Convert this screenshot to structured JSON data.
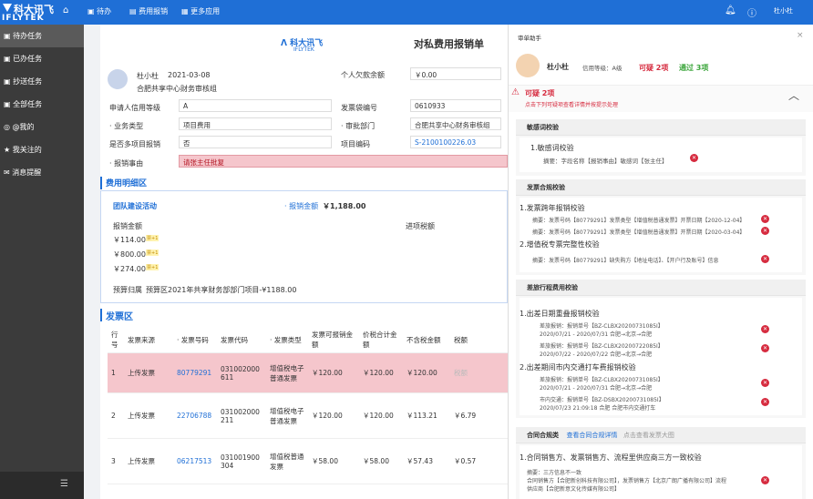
{
  "topbar": {
    "logo_cn": "科大讯飞",
    "logo_en": "IFLYTEK",
    "home_icon": "home-icon",
    "nav": [
      {
        "icon": "list-icon",
        "label": "待办"
      },
      {
        "icon": "money-icon",
        "label": "费用报销"
      },
      {
        "icon": "grid-icon",
        "label": "更多应用"
      }
    ],
    "user": "杜小杜"
  },
  "sidebar": {
    "items": [
      "待办任务",
      "已办任务",
      "抄送任务",
      "全部任务",
      "@我的",
      "我关注的",
      "消息提醒"
    ]
  },
  "form": {
    "brand_cn": "科大讯飞",
    "brand_en": "IFLYTEK",
    "title": "对私费用报销单",
    "applicant": "杜小杜",
    "date": "2021-03-08",
    "dept": "合肥共享中心财务审核组",
    "fields": [
      {
        "label": "个人欠款余额",
        "value": "￥0.00"
      },
      {
        "label": "申请人信用等级",
        "value": "A"
      },
      {
        "label": "发票袋编号",
        "value": "0610933"
      },
      {
        "label": "· 业务类型",
        "value": "项目费用"
      },
      {
        "label": "· 审批部门",
        "value": "合肥共享中心财务审核组"
      },
      {
        "label": "是否多项目报销",
        "value": "否"
      },
      {
        "label": "项目编码",
        "value": "S-2100100226.03"
      },
      {
        "label": "· 报销事由",
        "value": "请张主任批复"
      }
    ],
    "detail": {
      "title": "费用明细区",
      "activity": "团队建设活动",
      "amount_label": "· 报销金额",
      "amount": "￥1,188.00",
      "col1": "报销金额",
      "col2": "进项税额",
      "rows": [
        "￥114.00",
        "￥800.00",
        "￥274.00"
      ],
      "badge": "票+1",
      "budget_label": "预算归属",
      "budget": "预算区2021年共享财务部部门项目-¥1188.00"
    },
    "invoice": {
      "title": "发票区",
      "headers": [
        "行号",
        "发票来源",
        "· 发票号码",
        "发票代码",
        "· 发票类型",
        "发票可报销金额",
        "价税合计金额",
        "不含税金额",
        "税额"
      ],
      "rows": [
        {
          "no": "1",
          "source": "上传发票",
          "number": "80779291",
          "code": "031002000611",
          "type": "增值税电子普通发票",
          "avail": "￥120.00",
          "total": "￥120.00",
          "net": "￥120.00",
          "tax": "税额"
        },
        {
          "no": "2",
          "source": "上传发票",
          "number": "22706788",
          "code": "031002000211",
          "type": "增值税电子普通发票",
          "avail": "￥120.00",
          "total": "￥120.00",
          "net": "￥113.21",
          "tax": "￥6.79"
        },
        {
          "no": "3",
          "source": "上传发票",
          "number": "06217513",
          "code": "031001900304",
          "type": "增值税普通发票",
          "avail": "￥58.00",
          "total": "￥58.00",
          "net": "￥57.43",
          "tax": "￥0.57"
        }
      ]
    }
  },
  "assistant": {
    "title": "审单助手",
    "user": "杜小杜",
    "credit": "信用等级：A级",
    "doubt": "可疑 2项",
    "pass": "通过 3项",
    "alert_title": "可疑 2项",
    "alert_sub": "点击下列可疑项查看详情并按提示处理",
    "groups": [
      {
        "title": "敏感词校验",
        "items": [
          {
            "name": "1.敏感词校验",
            "lines": [
              "摘要：字段名称【报销事由】敏感词【张主任】"
            ]
          }
        ]
      },
      {
        "title": "发票合规校验",
        "items": [
          {
            "name": "1.发票跨年报销校验",
            "lines": [
              "摘要：发票号码【80779291】发票类型【增值税普通发票】开票日期【2020-12-04】",
              "摘要：发票号码【80779291】发票类型【增值税普通发票】开票日期【2020-03-04】"
            ]
          },
          {
            "name": "2.增值税专票完整性校验",
            "lines": [
              "摘要：发票号码【80779291】缺失购方【地址电话】、【开户行及账号】信息"
            ]
          }
        ]
      },
      {
        "title": "差旅行程费用校验",
        "items": [
          {
            "name": "1.出差日期重叠报销校验",
            "lines": [
              "差旅报销：报销单号【BZ-CLBX20200731085I】",
              "2020/07/21 - 2020/07/31 合肥→北京→合肥",
              "差旅报销：报销单号【BZ-CLBX20200722085I】",
              "2020/07/22 - 2020/07/22 合肥→北京→合肥"
            ]
          },
          {
            "name": "2.出差期间市内交通打车费报销校验",
            "lines": [
              "差旅报销：报销单号【BZ-CLBX20200731085I】",
              "2020/07/21 - 2020/07/31 合肥→北京→合肥",
              "市内交通：报销单号【BZ-DSBX20200731085I】",
              "2020/07/23 21:09:18  合肥 合肥市内交通打车"
            ]
          }
        ]
      },
      {
        "title": "合同合规类",
        "link": "查看合同合规详情",
        "hint": "点击查看发票大图",
        "items": [
          {
            "name": "1.合同销售方、发票销售方、流程里供应商三方一致校验",
            "lines": [
              "摘要：三方信息不一致",
              "合同销售方【合肥新创科技有限公司】，发票销售方【北京广朗广播有限公司】流程",
              "供应商【合肥新意文化传媒有限公司】"
            ]
          }
        ]
      }
    ]
  }
}
